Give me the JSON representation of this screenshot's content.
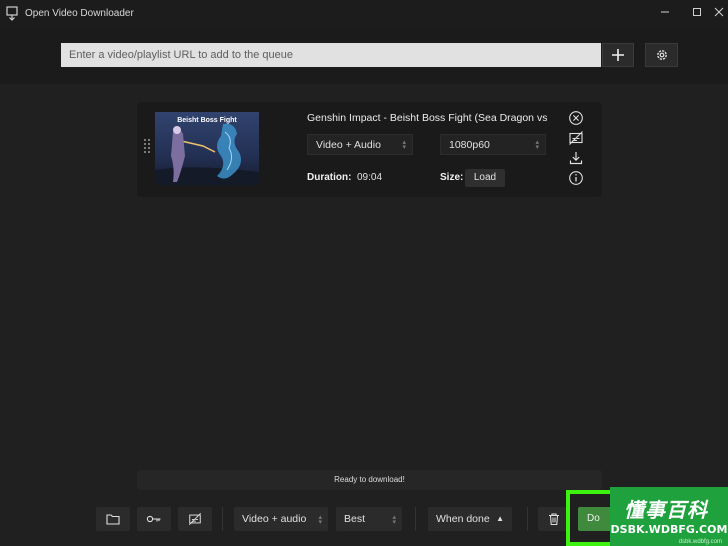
{
  "window": {
    "title": "Open Video Downloader",
    "controls": [
      "minimize-icon",
      "maximize-icon",
      "close-icon"
    ]
  },
  "toolbar": {
    "url_placeholder": "Enter a video/playlist URL to add to the queue",
    "add_icon": "plus-icon",
    "settings_icon": "gear-icon"
  },
  "queue": [
    {
      "thumbnail_text": "Beisht Boss Fight",
      "title": "Genshin Impact - Beisht Boss Fight (Sea Dragon vs",
      "format": "Video + Audio",
      "quality": "1080p60",
      "duration_label": "Duration:",
      "duration": "09:04",
      "size_label": "Size:",
      "load_label": "Load",
      "actions": [
        "remove-icon",
        "no-subtitles-icon",
        "download-icon",
        "info-icon"
      ]
    }
  ],
  "status": {
    "text": "Ready to download!"
  },
  "bottom": {
    "format": "Video + audio",
    "quality": "Best",
    "when_done": "When done",
    "download_label": "Do"
  },
  "watermark": {
    "cn": "懂事百科",
    "domain": "DSBK.WDBFG.COM",
    "small": "dsbk.wdbfg.com"
  },
  "colors": {
    "background": "#202020",
    "accent_green": "#3f8a3c",
    "highlight": "#3ef20f",
    "watermark": "#1fa23d"
  }
}
